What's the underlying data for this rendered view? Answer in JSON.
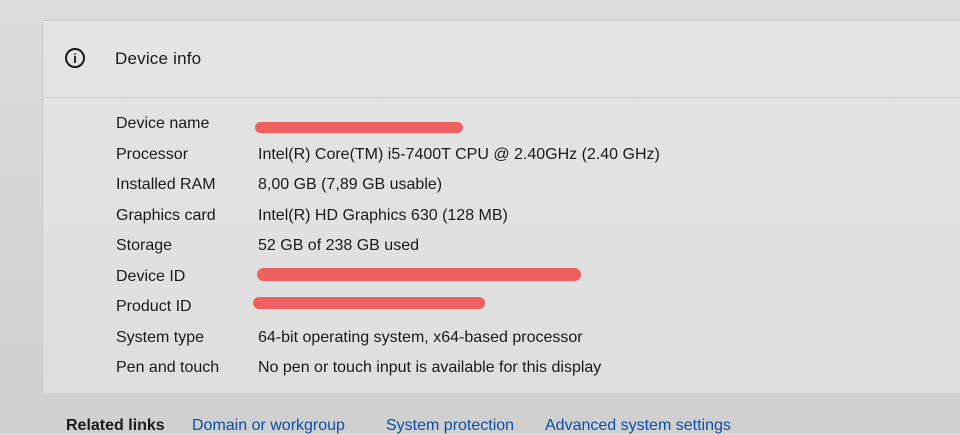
{
  "section": {
    "title": "Device info",
    "icon": "info-icon"
  },
  "specs": [
    {
      "label": "Device name",
      "value": ""
    },
    {
      "label": "Processor",
      "value": "Intel(R) Core(TM) i5-7400T CPU @ 2.40GHz (2.40 GHz)"
    },
    {
      "label": "Installed RAM",
      "value": "8,00 GB (7,89 GB usable)"
    },
    {
      "label": "Graphics card",
      "value": "Intel(R) HD Graphics 630 (128 MB)"
    },
    {
      "label": "Storage",
      "value": "52 GB of 238 GB used"
    },
    {
      "label": "Device ID",
      "value": ""
    },
    {
      "label": "Product ID",
      "value": ""
    },
    {
      "label": "System type",
      "value": "64-bit operating system, x64-based processor"
    },
    {
      "label": "Pen and touch",
      "value": "No pen or touch input is available for this display"
    }
  ],
  "related_links": {
    "label": "Related links",
    "items": [
      "Domain or workgroup",
      "System protection",
      "Advanced system settings"
    ]
  },
  "colors": {
    "redaction": "#f0595a",
    "link": "#0b4fa3"
  }
}
